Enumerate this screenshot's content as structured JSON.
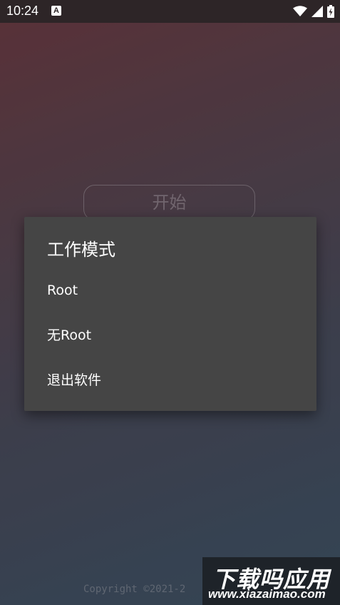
{
  "status_bar": {
    "time": "10:24",
    "notification_icon": "A",
    "icons": [
      "wifi-icon",
      "signal-icon",
      "battery-icon"
    ]
  },
  "main": {
    "start_button_label": "开始",
    "copyright": "Copyright ©2021-2"
  },
  "dialog": {
    "title": "工作模式",
    "items": [
      {
        "label": "Root"
      },
      {
        "label": "无Root"
      },
      {
        "label": "退出软件"
      }
    ]
  },
  "watermark": {
    "title": "下载吗应用",
    "url": "www.xiazaimao.com"
  },
  "colors": {
    "dialog_bg": "#454545",
    "status_bar_bg": "#2d2527",
    "text": "#ffffff"
  }
}
